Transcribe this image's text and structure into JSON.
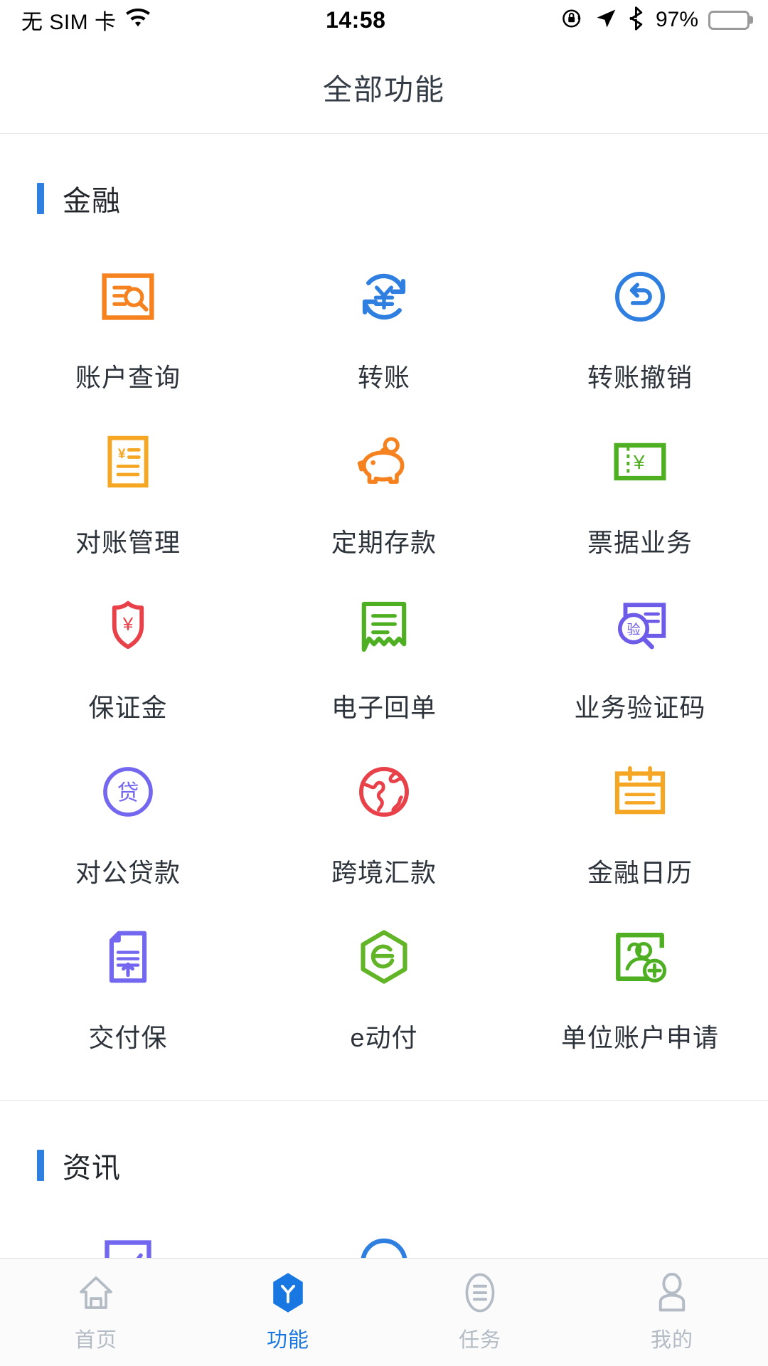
{
  "statusbar": {
    "carrier": "无 SIM 卡",
    "wifi_icon": "wifi-icon",
    "time": "14:58",
    "rotation_lock_icon": "rotation-lock-icon",
    "location_icon": "location-arrow-icon",
    "bluetooth_icon": "bluetooth-icon",
    "battery_percent": "97%",
    "battery_icon": "battery-icon",
    "battery_level": 97
  },
  "header": {
    "title": "全部功能"
  },
  "sections": [
    {
      "id": "finance",
      "title": "金融",
      "accent": "#2f7fe0",
      "items": [
        {
          "label": "账户查询",
          "icon": "account-query-icon",
          "color": "#f5821f"
        },
        {
          "label": "转账",
          "icon": "transfer-icon",
          "color": "#2f7fe0"
        },
        {
          "label": "转账撤销",
          "icon": "transfer-cancel-icon",
          "color": "#2f7fe0"
        },
        {
          "label": "对账管理",
          "icon": "reconciliation-icon",
          "color": "#f5a623"
        },
        {
          "label": "定期存款",
          "icon": "piggy-bank-icon",
          "color": "#f5821f"
        },
        {
          "label": "票据业务",
          "icon": "bill-business-icon",
          "color": "#4faf22"
        },
        {
          "label": "保证金",
          "icon": "shield-deposit-icon",
          "color": "#e8414a"
        },
        {
          "label": "电子回单",
          "icon": "e-receipt-icon",
          "color": "#4faf22"
        },
        {
          "label": "业务验证码",
          "icon": "verification-code-icon",
          "color": "#6c5ce7"
        },
        {
          "label": "对公贷款",
          "icon": "corporate-loan-icon",
          "color": "#7367f0"
        },
        {
          "label": "跨境汇款",
          "icon": "cross-border-remit-icon",
          "color": "#e8414a"
        },
        {
          "label": "金融日历",
          "icon": "finance-calendar-icon",
          "color": "#f5a623"
        },
        {
          "label": "交付保",
          "icon": "delivery-guarantee-icon",
          "color": "#7367f0"
        },
        {
          "label": "e动付",
          "icon": "e-pay-icon",
          "color": "#62b526"
        },
        {
          "label": "单位账户申请",
          "icon": "unit-account-apply-icon",
          "color": "#4faf22"
        }
      ]
    },
    {
      "id": "news",
      "title": "资讯",
      "accent": "#2f7fe0",
      "items": [
        {
          "label": "",
          "icon": "market-chart-icon",
          "color": "#7367f0"
        },
        {
          "label": "",
          "icon": "fx-rate-icon",
          "color": "#2f7fe0"
        }
      ]
    }
  ],
  "tabbar": {
    "items": [
      {
        "label": "首页",
        "icon": "home-icon",
        "active": false
      },
      {
        "label": "功能",
        "icon": "functions-icon",
        "active": true
      },
      {
        "label": "任务",
        "icon": "tasks-icon",
        "active": false
      },
      {
        "label": "我的",
        "icon": "profile-icon",
        "active": false
      }
    ],
    "active_color": "#1877e0",
    "inactive_color": "#b3bbc4"
  }
}
